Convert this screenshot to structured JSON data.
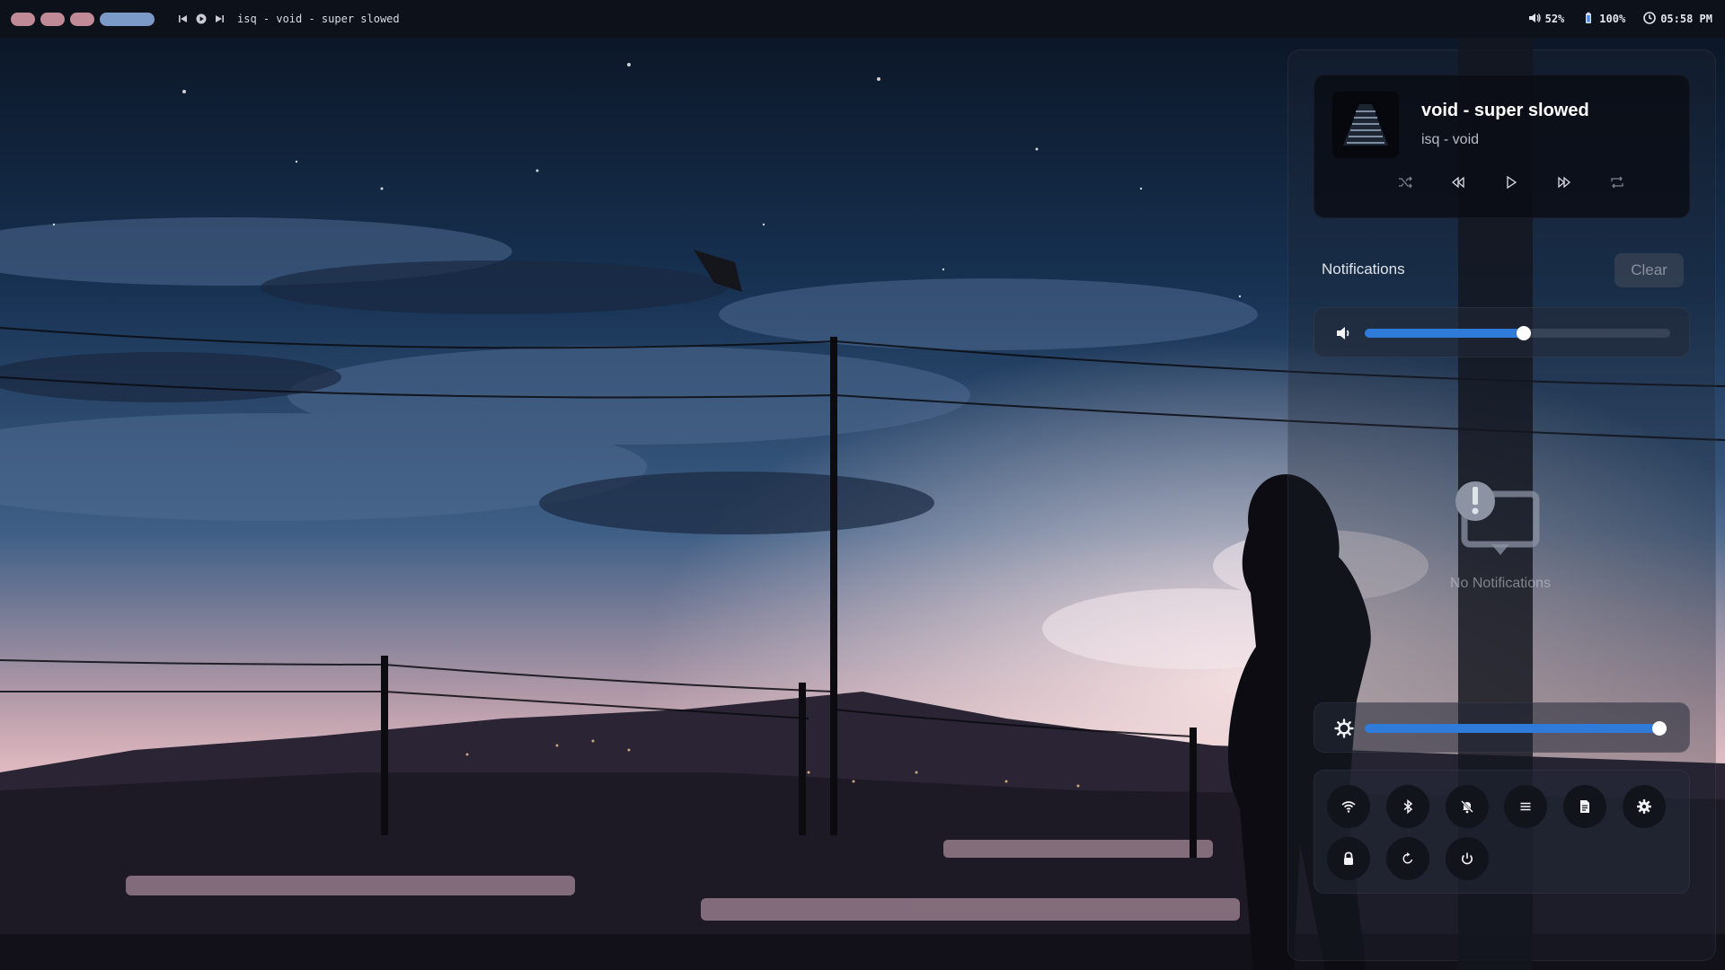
{
  "topbar": {
    "workspaces": [
      {
        "label": "workspace-1",
        "active": false
      },
      {
        "label": "workspace-2",
        "active": false
      },
      {
        "label": "workspace-3",
        "active": false
      },
      {
        "label": "workspace-4",
        "active": true
      }
    ],
    "media": {
      "title": "isq - void - super slowed",
      "controls": [
        "previous-icon",
        "play-icon",
        "next-icon"
      ]
    },
    "tray": {
      "volume": "52%",
      "battery": "100%",
      "clock": "05:58 PM"
    }
  },
  "control_center": {
    "media": {
      "song": "void - super slowed",
      "artist": "isq - void",
      "controls": [
        "shuffle-icon",
        "rewind-icon",
        "play-icon",
        "fast-forward-icon",
        "repeat-icon"
      ]
    },
    "notifications": {
      "title": "Notifications",
      "clear_label": "Clear",
      "empty_label": "No Notifications"
    },
    "volume_slider": {
      "value": 0.52,
      "icon": "speaker-icon"
    },
    "brightness_slider": {
      "value": 1.0,
      "icon": "sun-icon"
    },
    "quick_buttons": [
      "wifi-icon",
      "bluetooth-icon",
      "bell-off-icon",
      "menu-icon",
      "document-icon",
      "gear-icon",
      "lock-icon",
      "restart-icon",
      "power-icon"
    ]
  },
  "colors": {
    "accent": "#2f7bd9",
    "workspace_inactive": "#c08a97",
    "workspace_active": "#7c9ac8",
    "bar_background": "#0d111a"
  }
}
